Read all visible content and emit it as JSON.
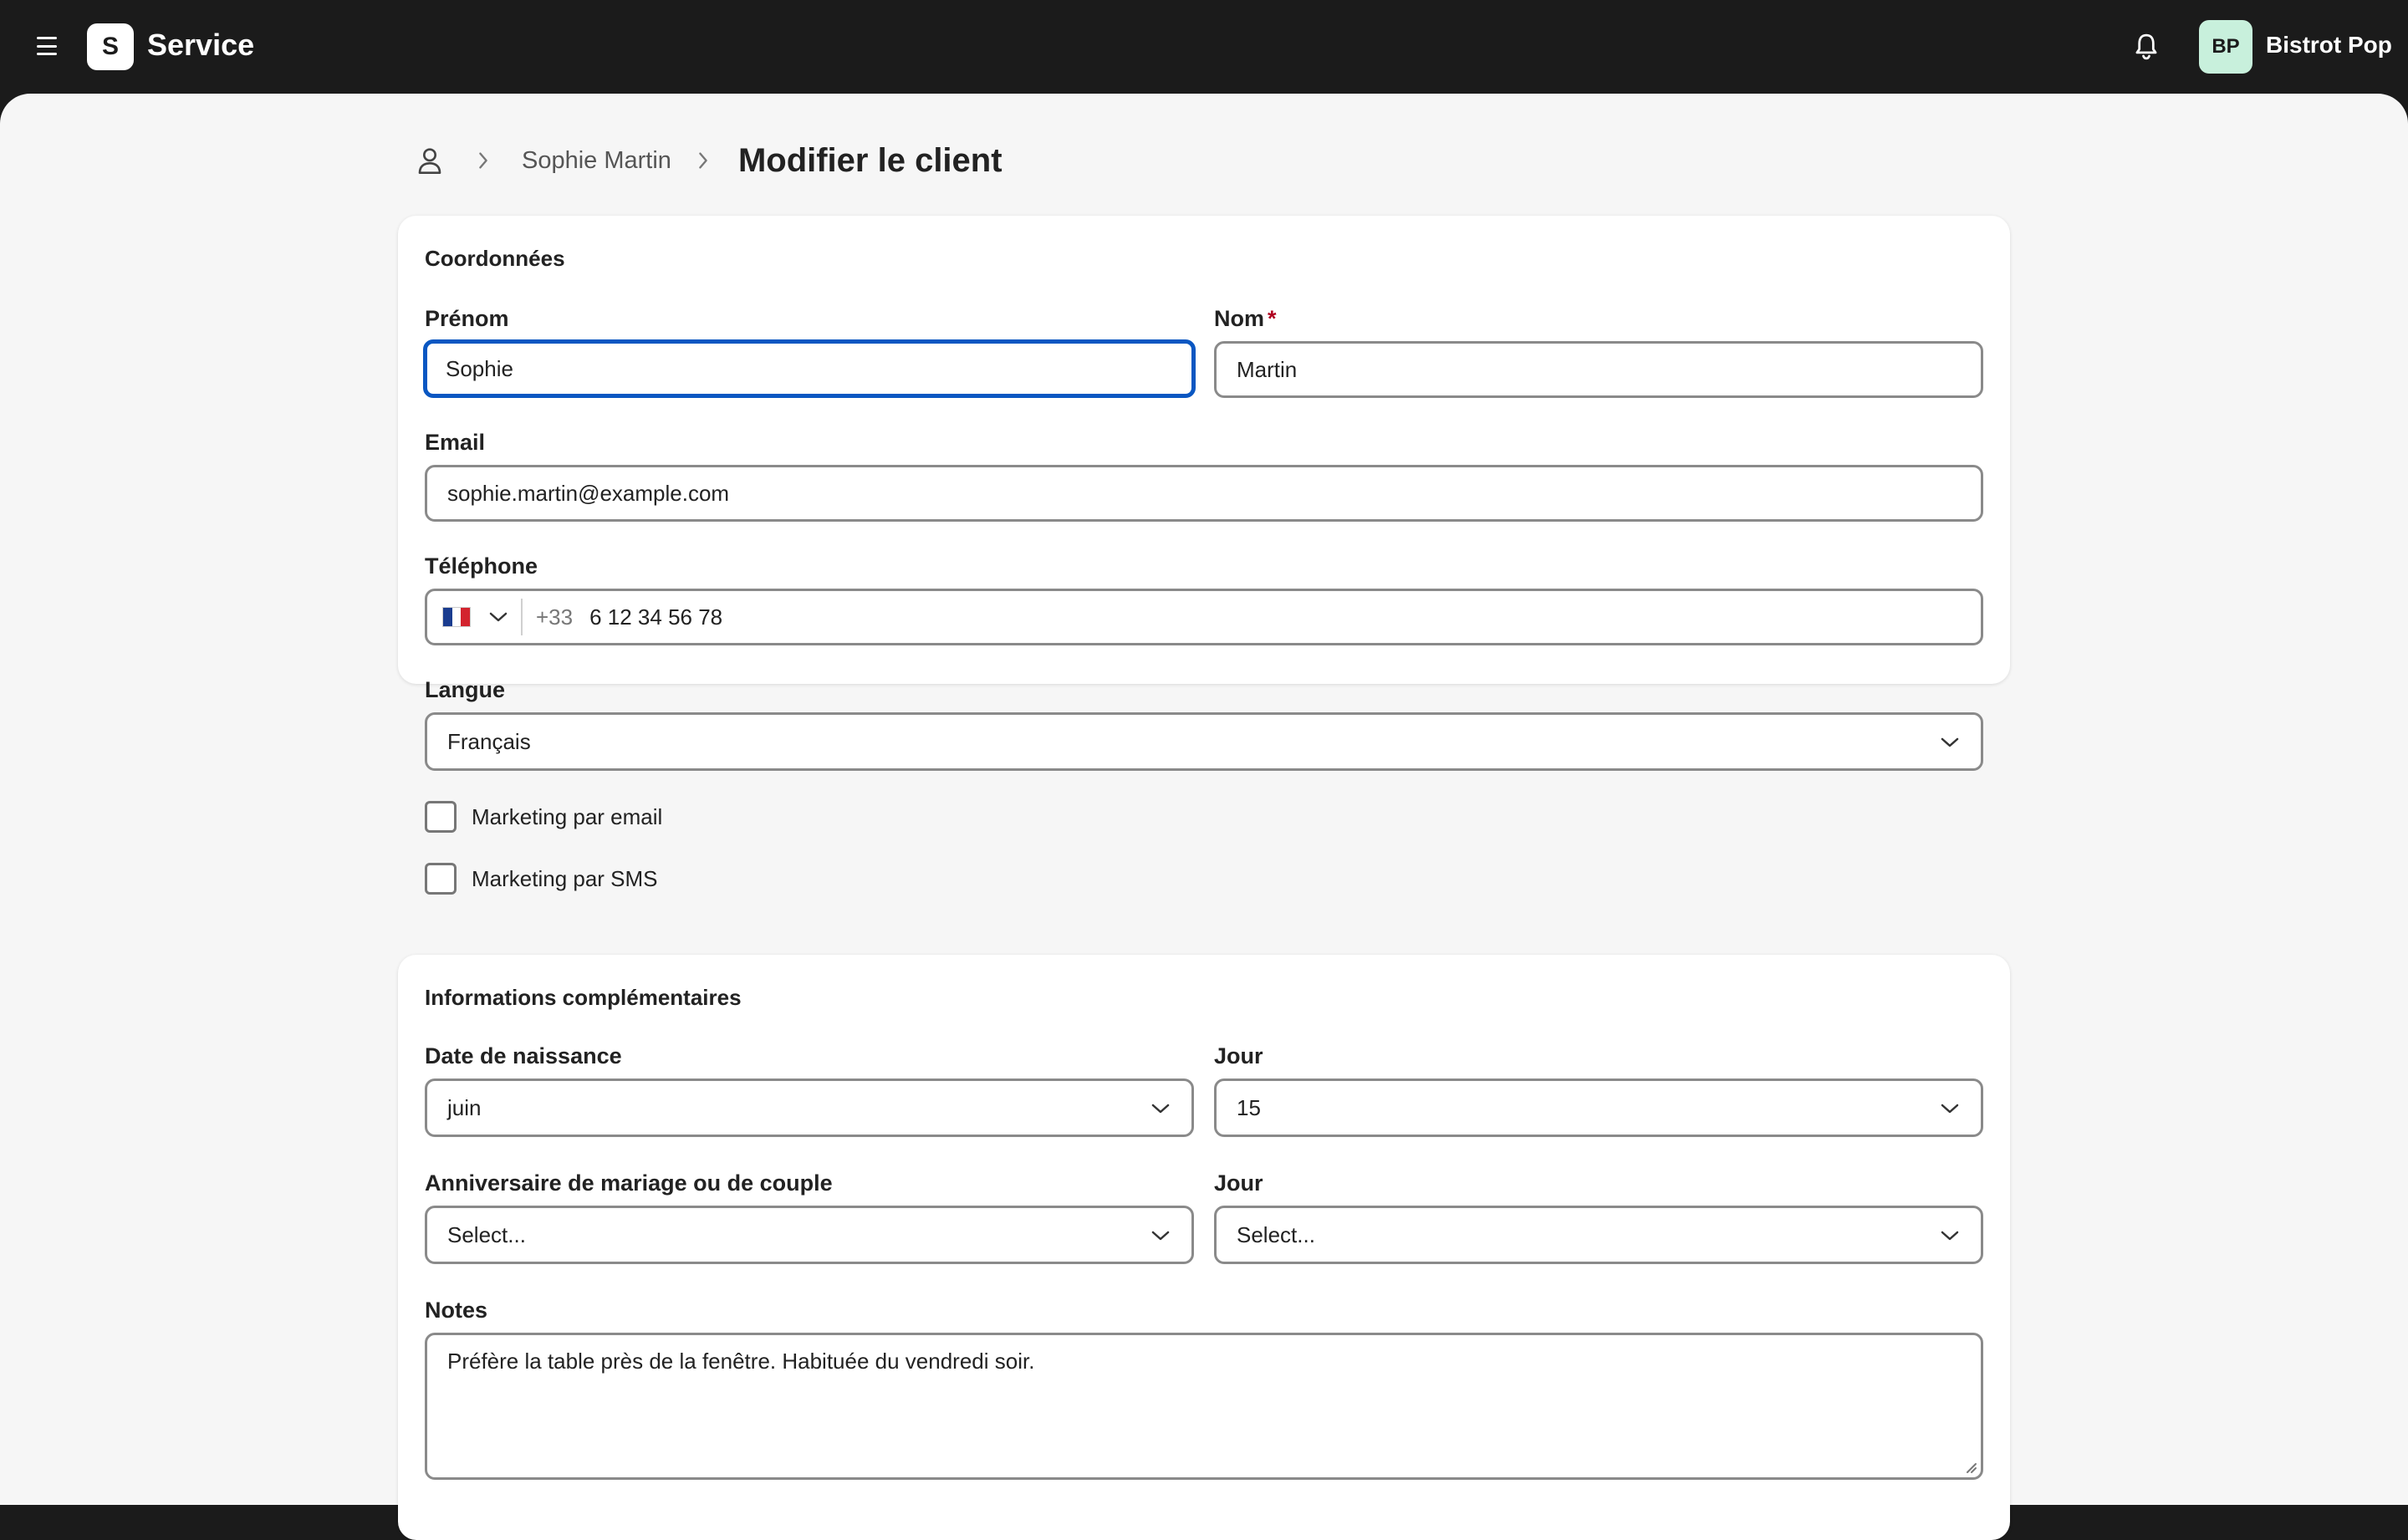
{
  "header": {
    "app_logo_letter": "S",
    "app_name": "Service",
    "avatar_initials": "BP",
    "account_name": "Bistrot Pop"
  },
  "breadcrumb": {
    "parent": "Sophie Martin",
    "current": "Modifier le client"
  },
  "contact_card": {
    "title": "Coordonnées",
    "first_name_label": "Prénom",
    "first_name_value": "Sophie",
    "last_name_label": "Nom",
    "last_name_required": "*",
    "last_name_value": "Martin",
    "email_label": "Email",
    "email_value": "sophie.martin@example.com",
    "phone_label": "Téléphone",
    "phone_prefix": "+33",
    "phone_value": "6 12 34 56 78",
    "language_label": "Langue",
    "language_value": "Français",
    "email_marketing_label": "Marketing par email",
    "sms_marketing_label": "Marketing par SMS"
  },
  "extra_card": {
    "title": "Informations complémentaires",
    "birth_date_label": "Date de naissance",
    "birth_month_value": "juin",
    "birth_day_label": "Jour",
    "birth_day_value": "15",
    "anniversary_label": "Anniversaire de mariage ou de couple",
    "anniversary_month_value": "Select...",
    "anniversary_day_label": "Jour",
    "anniversary_day_value": "Select...",
    "notes_label": "Notes",
    "notes_value": "Préfère la table près de la fenêtre. Habituée du vendredi soir."
  },
  "colors": {
    "topbar": "#1b1b1b",
    "focus_border": "#0a57c2",
    "avatar_bg": "#c8f0dc",
    "required": "#b00020"
  },
  "icons": {
    "menu": "hamburger-icon",
    "notifications": "bell-icon",
    "breadcrumb_root": "user-icon",
    "separator": "chevron-right-icon",
    "select": "chevron-down-icon",
    "country": "flag-fr-icon"
  }
}
